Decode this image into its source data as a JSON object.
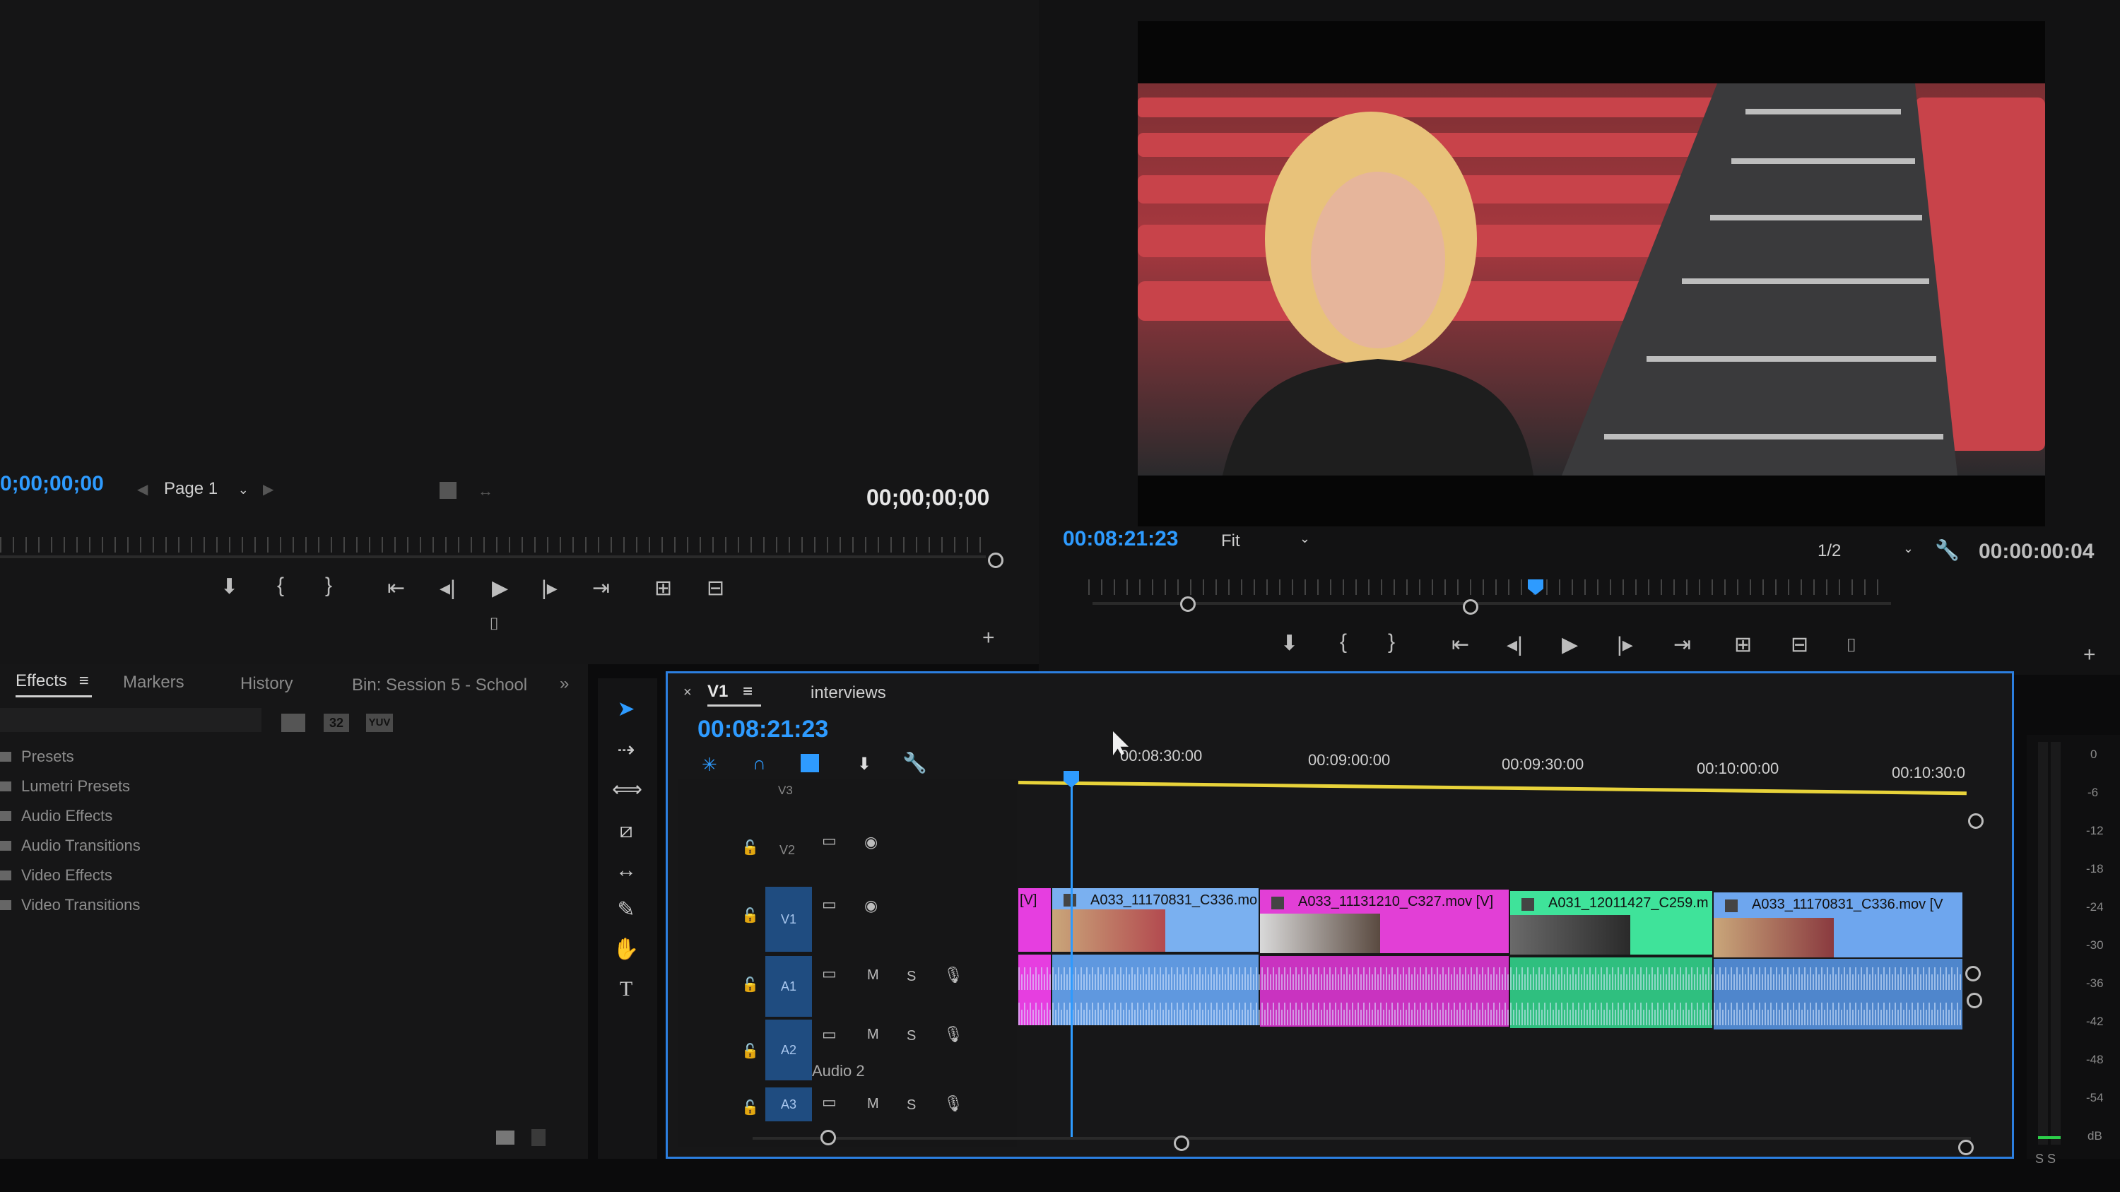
{
  "source_monitor": {
    "timecode_left": "0;00;00;00",
    "page_label": "Page 1",
    "timecode_right": "00;00;00;00"
  },
  "program_monitor": {
    "timecode": "00:08:21:23",
    "zoom": "Fit",
    "resolution": "1/2",
    "duration": "00:00:00:04"
  },
  "project_panel": {
    "tabs": [
      "Effects",
      "Markers",
      "History",
      "Bin: Session 5 - School"
    ],
    "folders": [
      "Presets",
      "Lumetri Presets",
      "Audio Effects",
      "Audio Transitions",
      "Video Effects",
      "Video Transitions"
    ],
    "buttons": [
      "32",
      "YUV"
    ]
  },
  "timeline": {
    "tab_active": "V1",
    "sequence_name": "interviews",
    "timecode": "00:08:21:23",
    "ruler_labels": [
      "00:08:30:00",
      "00:09:00:00",
      "00:09:30:00",
      "00:10:00:00",
      "00:10:30:0"
    ],
    "tracks": {
      "v3": "V3",
      "v2": "V2",
      "v1": "V1",
      "a1": "A1",
      "a2": "A2",
      "a3": "A3",
      "audio2_name": "Audio 2",
      "m": "M",
      "s": "S"
    },
    "clips": [
      {
        "name": "[V]",
        "color": "#e63ee0"
      },
      {
        "name": "A033_11170831_C336.mo",
        "color": "#7ab0f0"
      },
      {
        "name": "A033_11131210_C327.mov [V]",
        "color": "#e23fd6"
      },
      {
        "name": "A031_12011427_C259.m",
        "color": "#3fe39a"
      },
      {
        "name": "A033_11170831_C336.mov [V",
        "color": "#6ea6ee"
      }
    ]
  },
  "meter": {
    "scale": [
      "0",
      "-6",
      "-12",
      "-18",
      "-24",
      "-30",
      "-36",
      "-42",
      "-48",
      "-54",
      "dB"
    ],
    "solo": "S S"
  },
  "colors": {
    "accent": "#2e9bff",
    "selection_border": "#2c7fe0",
    "timeline_bar": "#e8d33a"
  }
}
